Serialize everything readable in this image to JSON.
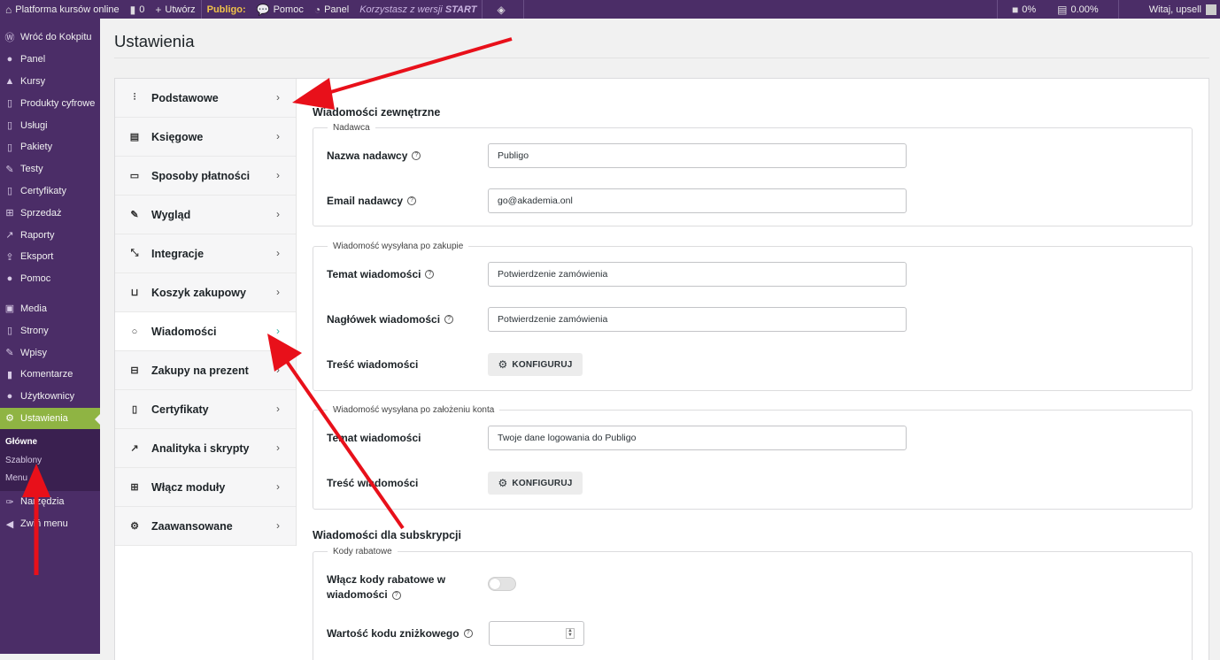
{
  "topbar": {
    "site": "Platforma kursów online",
    "comments": "0",
    "create": "Utwórz",
    "brand": "Publigo:",
    "help": "Pomoc",
    "panel": "Panel",
    "version_prefix": "Korzystasz z wersji",
    "version": "START",
    "stat1": "0%",
    "stat2": "0.00%",
    "greeting": "Witaj, upsell"
  },
  "sidebar": {
    "items_top": [
      "Wróć do Kokpitu",
      "Panel",
      "Kursy",
      "Produkty cyfrowe",
      "Usługi",
      "Pakiety",
      "Testy",
      "Certyfikaty",
      "Sprzedaż",
      "Raporty",
      "Eksport",
      "Pomoc"
    ],
    "items_mid": [
      "Media",
      "Strony",
      "Wpisy",
      "Komentarze",
      "Użytkownicy"
    ],
    "active": "Ustawienia",
    "sub": [
      "Główne",
      "Szablony",
      "Menu"
    ],
    "items_bottom": [
      "Narzędzia",
      "Zwiń menu"
    ]
  },
  "page": {
    "title": "Ustawienia"
  },
  "nav": [
    "Podstawowe",
    "Księgowe",
    "Sposoby płatności",
    "Wygląd",
    "Integracje",
    "Koszyk zakupowy",
    "Wiadomości",
    "Zakupy na prezent",
    "Certyfikaty",
    "Analityka i skrypty",
    "Włącz moduły",
    "Zaawansowane"
  ],
  "nav_selected": "Wiadomości",
  "form": {
    "section1": "Wiadomości zewnętrzne",
    "sender": {
      "legend": "Nadawca",
      "name_label": "Nazwa nadawcy",
      "name_value": "Publigo",
      "email_label": "Email nadawcy",
      "email_value": "go@akademia.onl"
    },
    "purchase": {
      "legend": "Wiadomość wysyłana po zakupie",
      "subject_label": "Temat wiadomości",
      "subject_value": "Potwierdzenie zamówienia",
      "header_label": "Nagłówek wiadomości",
      "header_value": "Potwierdzenie zamówienia",
      "body_label": "Treść wiadomości",
      "button": "KONFIGURUJ"
    },
    "account": {
      "legend": "Wiadomość wysyłana po założeniu konta",
      "subject_label": "Temat wiadomości",
      "subject_value": "Twoje dane logowania do Publigo",
      "body_label": "Treść wiadomości",
      "button": "KONFIGURUJ"
    },
    "section2": "Wiadomości dla subskrypcji",
    "discount": {
      "legend": "Kody rabatowe",
      "toggle_label_1": "Włącz kody rabatowe w",
      "toggle_label_2": "wiadomości",
      "value_label": "Wartość kodu zniżkowego",
      "value": ""
    }
  },
  "colors": {
    "sidebar": "#4b2d67",
    "active": "#8fb443",
    "annotation": "#e8101a"
  }
}
